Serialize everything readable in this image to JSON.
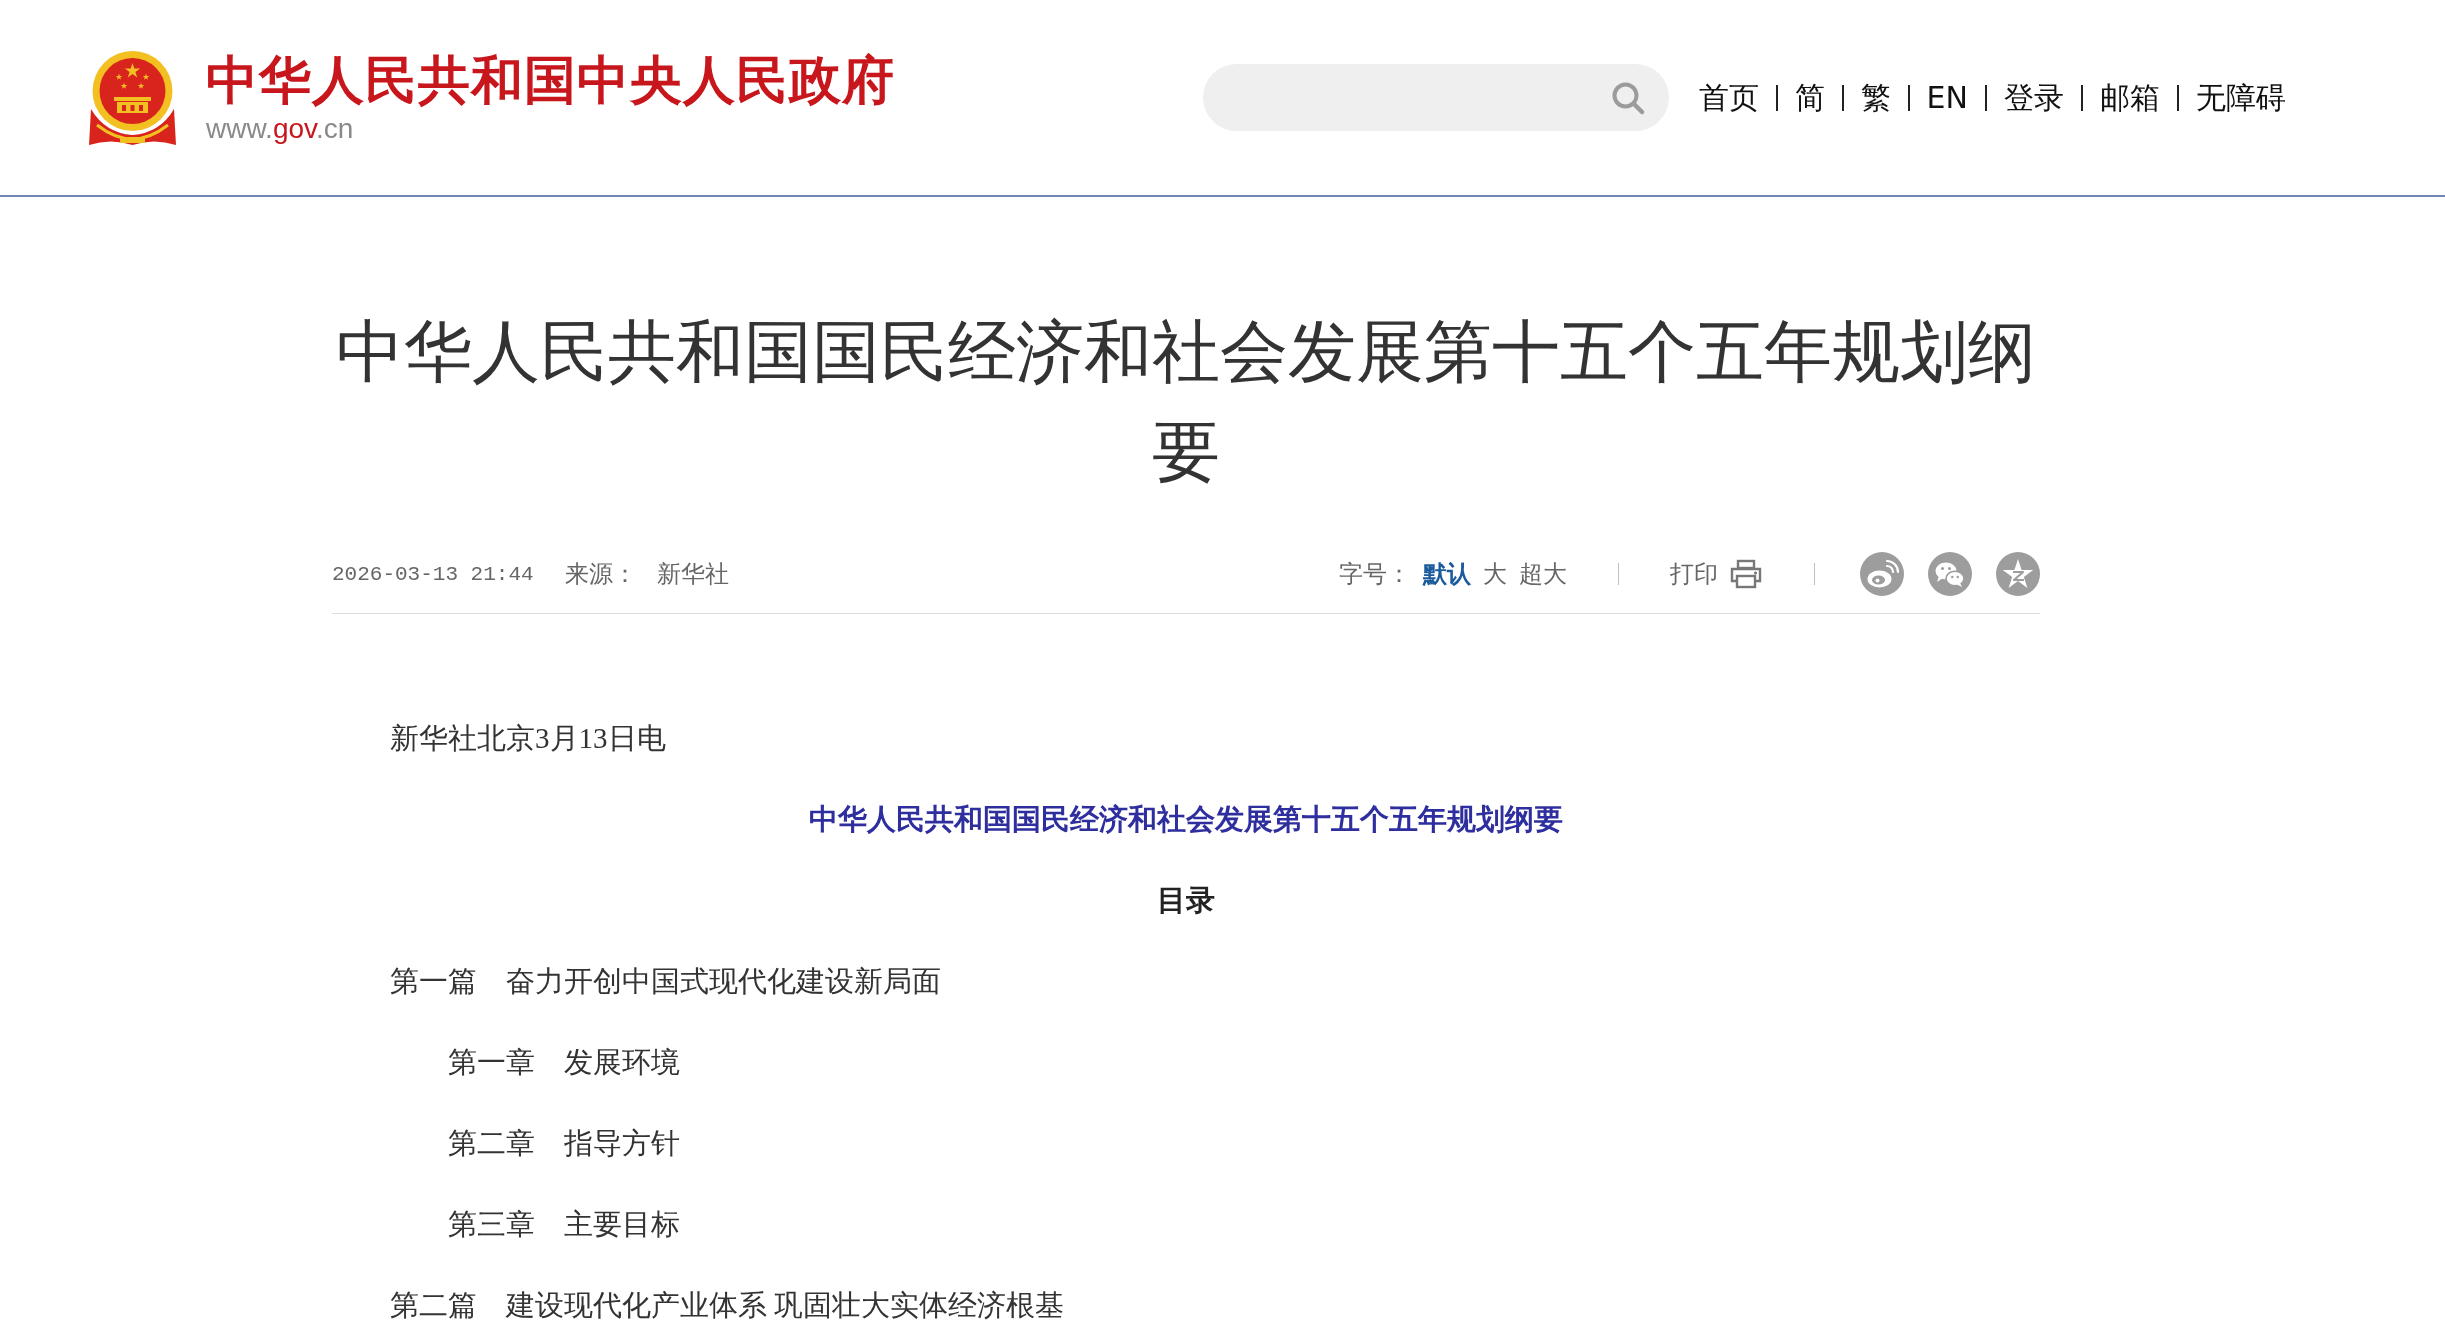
{
  "header": {
    "site_title": "中华人民共和国中央人民政府",
    "site_url": [
      {
        "text": "www.",
        "accent": false
      },
      {
        "text": "gov",
        "accent": true
      },
      {
        "text": ".cn",
        "accent": false
      }
    ],
    "nav": [
      "首页",
      "简",
      "繁",
      "EN",
      "登录",
      "邮箱",
      "无障碍"
    ]
  },
  "article": {
    "title": "中华人民共和国国民经济和社会发展第十五个五年规划纲要",
    "meta": {
      "date": "2026-03-13 21:44",
      "source_label": "来源：",
      "source": "新华社",
      "font_size_label": "字号：",
      "font_sizes": [
        {
          "label": "默认",
          "selected": true
        },
        {
          "label": "大",
          "selected": false
        },
        {
          "label": "超大",
          "selected": false
        }
      ],
      "print": "打印"
    },
    "body": [
      {
        "kind": "paragraph",
        "text": "新华社北京3月13日电"
      },
      {
        "kind": "heading",
        "text": "中华人民共和国国民经济和社会发展第十五个五年规划纲要"
      },
      {
        "kind": "subheading",
        "text": "目录"
      },
      {
        "kind": "part",
        "text": "第一篇　奋力开创中国式现代化建设新局面",
        "children": [
          {
            "kind": "chapter",
            "text": "第一章　发展环境"
          },
          {
            "kind": "chapter",
            "text": "第二章　指导方针"
          },
          {
            "kind": "chapter",
            "text": "第三章　主要目标"
          }
        ]
      },
      {
        "kind": "part",
        "text": "第二篇　建设现代化产业体系 巩固壮大实体经济根基"
      }
    ]
  }
}
